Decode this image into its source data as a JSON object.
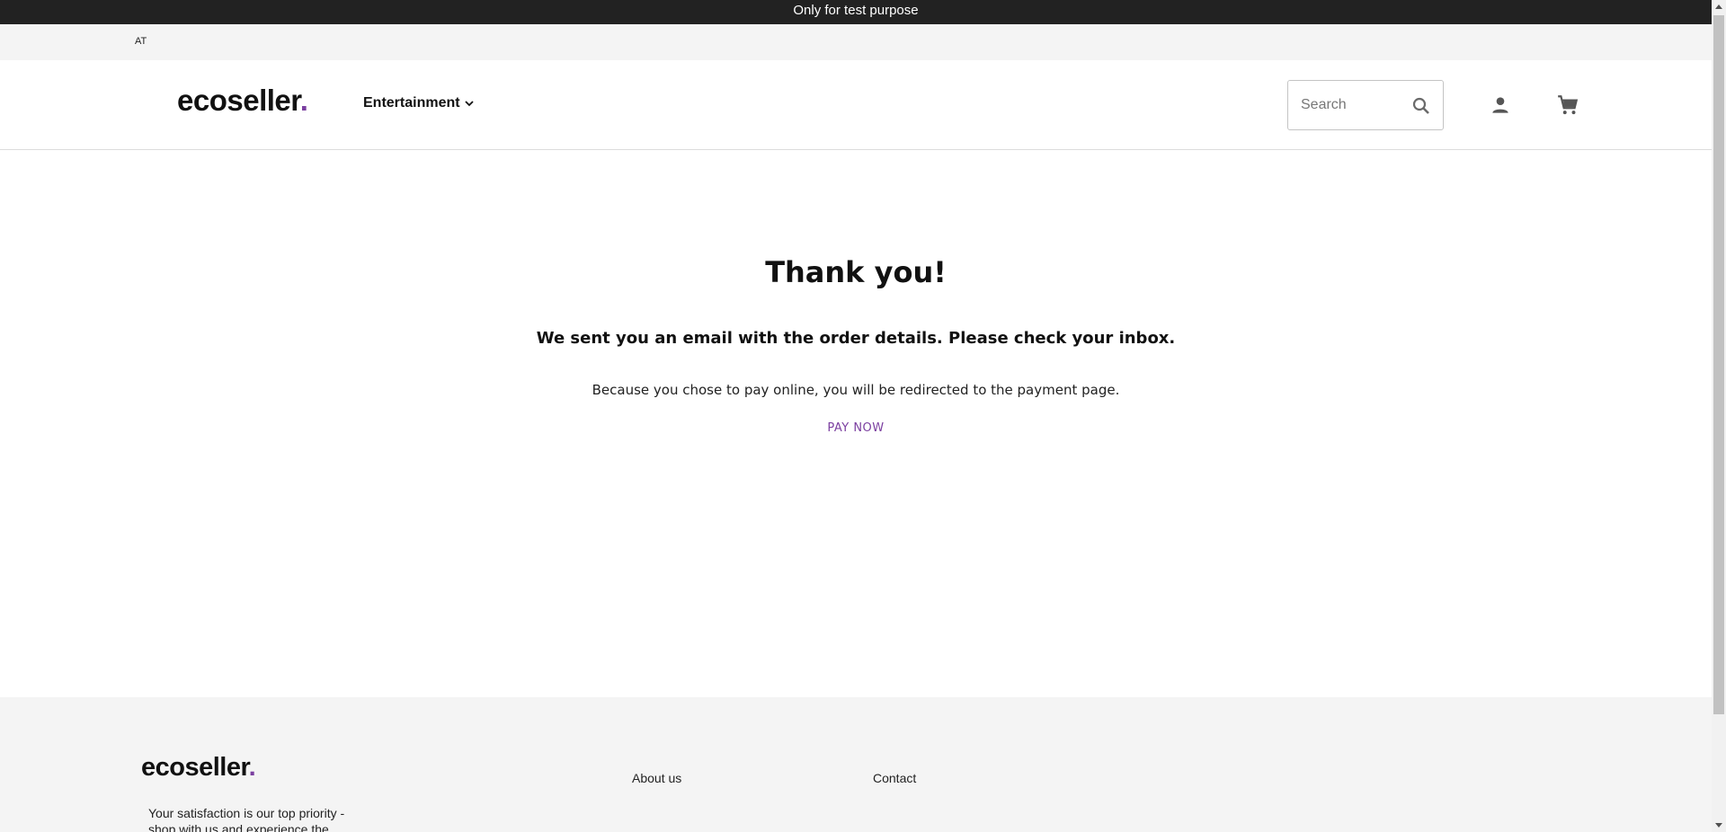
{
  "announcement": {
    "text": "Only for test purpose"
  },
  "country_bar": {
    "country_code": "AT"
  },
  "header": {
    "logo_text": "ecoseller",
    "logo_dot": ".",
    "nav_items": [
      {
        "label": "Entertainment",
        "icon": "chevron-down-icon"
      }
    ],
    "search": {
      "placeholder": "Search",
      "value": "",
      "icon": "search-icon"
    },
    "account_icon": "user-icon",
    "cart_icon": "cart-icon"
  },
  "main": {
    "title": "Thank you!",
    "email_message": "We sent you an email with the order details. Please check your inbox.",
    "redirect_message": "Because you chose to pay online, you will be redirected to the payment page.",
    "pay_now_label": "PAY NOW"
  },
  "footer": {
    "logo_text": "ecoseller",
    "logo_dot": ".",
    "tagline": "Your satisfaction is our top priority - shop with us and experience the",
    "links": [
      {
        "label": "About us"
      },
      {
        "label": "Contact"
      }
    ]
  },
  "colors": {
    "accent": "#7b3fa0",
    "announcement_bg": "#222222",
    "footer_bg": "#f4f4f4"
  }
}
